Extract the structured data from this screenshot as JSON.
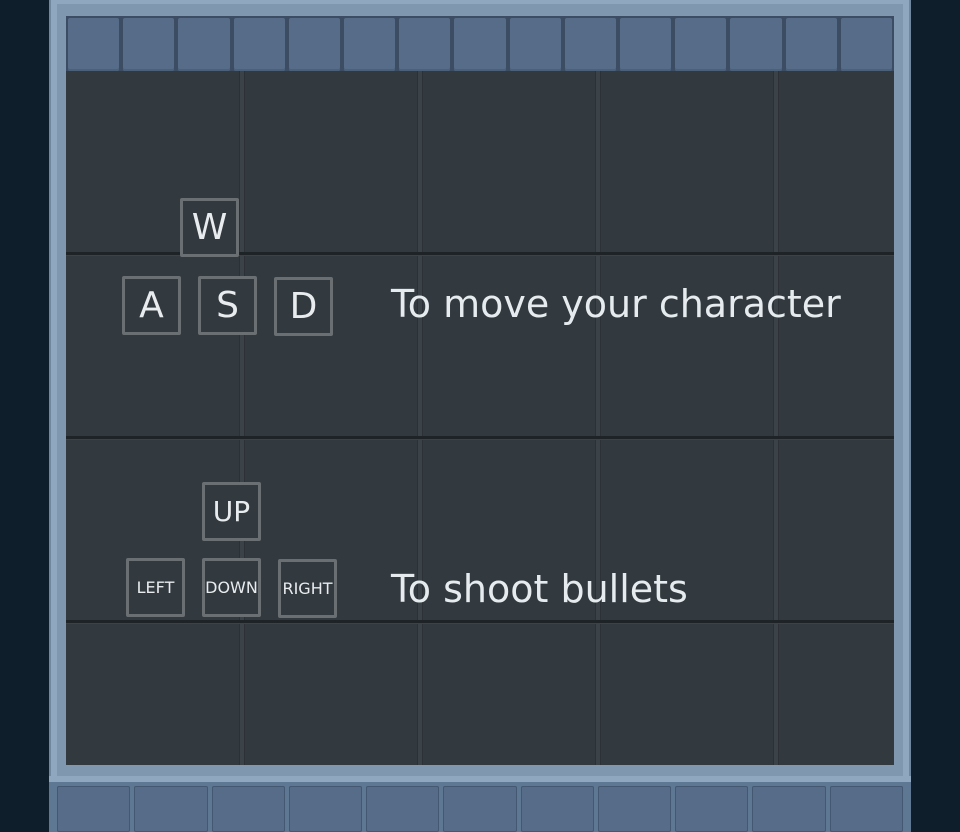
{
  "movement": {
    "keys": {
      "up": "W",
      "left": "A",
      "down": "S",
      "right": "D"
    },
    "caption": "To move your character"
  },
  "shooting": {
    "keys": {
      "up": "UP",
      "left": "LEFT",
      "down": "DOWN",
      "right": "RIGHT"
    },
    "caption": "To shoot bullets"
  },
  "colors": {
    "background": "#0f1e2b",
    "wall": "#566c89",
    "floor": "#32393f",
    "key_border": "#6a6f73",
    "text": "#e5ebee"
  }
}
